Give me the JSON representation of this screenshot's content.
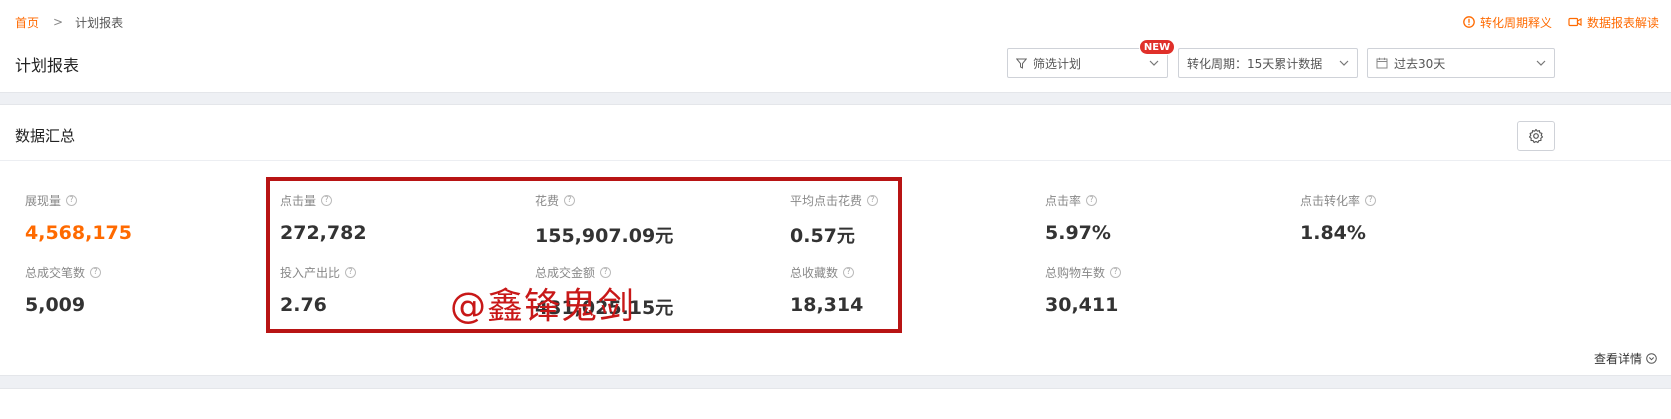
{
  "breadcrumb": {
    "home": "首页",
    "current": "计划报表"
  },
  "header": {
    "title": "计划报表",
    "links": [
      {
        "label": "转化周期释义",
        "icon": "alert-circle-icon"
      },
      {
        "label": "数据报表解读",
        "icon": "video-icon"
      }
    ],
    "filter_plan": {
      "label": "筛选计划",
      "badge": "NEW"
    },
    "conversion_cycle": {
      "label": "转化周期：15天累计数据"
    },
    "date_range": {
      "label": "过去30天"
    }
  },
  "summary": {
    "title": "数据汇总",
    "metrics": [
      {
        "label": "展现量",
        "value": "4,568,175",
        "unit": ""
      },
      {
        "label": "点击量",
        "value": "272,782",
        "unit": ""
      },
      {
        "label": "花费",
        "value": "155,907.09",
        "unit": "元"
      },
      {
        "label": "平均点击花费",
        "value": "0.57",
        "unit": "元"
      },
      {
        "label": "点击率",
        "value": "5.97%",
        "unit": ""
      },
      {
        "label": "点击转化率",
        "value": "1.84%",
        "unit": ""
      },
      {
        "label": "总成交笔数",
        "value": "5,009",
        "unit": ""
      },
      {
        "label": "投入产出比",
        "value": "2.76",
        "unit": ""
      },
      {
        "label": "总成交金额",
        "value": "431,025.15",
        "unit": "元"
      },
      {
        "label": "总收藏数",
        "value": "18,314",
        "unit": ""
      },
      {
        "label": "总购物车数",
        "value": "30,411",
        "unit": ""
      }
    ],
    "detail_link": "查看详情"
  },
  "watermark": "@鑫锋鬼剑",
  "colors": {
    "accent": "#ff6a00",
    "highlight": "#b81414",
    "badge": "#e0302a"
  }
}
